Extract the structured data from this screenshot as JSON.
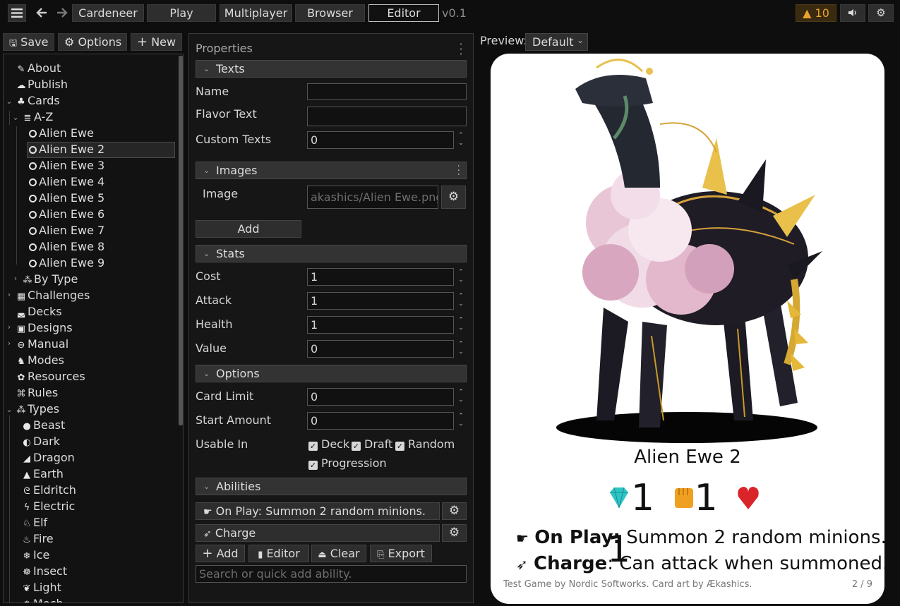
{
  "topbar": {
    "menu_icon": "hamburger-icon",
    "back_icon": "arrow-left-icon",
    "forward_icon": "arrow-right-icon",
    "tabs": [
      "Cardeneer",
      "Play",
      "Multiplayer",
      "Browser",
      "Editor"
    ],
    "active_tab": "Editor",
    "version": "v0.1",
    "warning_count": "10",
    "warning_icon": "warning-icon",
    "sound_icon": "speaker-icon",
    "settings_icon": "gear-icon"
  },
  "left": {
    "save_label": "Save",
    "options_label": "Options",
    "new_label": "New",
    "tree": {
      "about": "About",
      "publish": "Publish",
      "cards": "Cards",
      "az": "A-Z",
      "cards_list": [
        "Alien Ewe",
        "Alien Ewe 2",
        "Alien Ewe 3",
        "Alien Ewe 4",
        "Alien Ewe 5",
        "Alien Ewe 6",
        "Alien Ewe 7",
        "Alien Ewe 8",
        "Alien Ewe 9"
      ],
      "selected": "Alien Ewe 2",
      "by_type": "By Type",
      "challenges": "Challenges",
      "decks": "Decks",
      "designs": "Designs",
      "manual": "Manual",
      "modes": "Modes",
      "resources": "Resources",
      "rules": "Rules",
      "types": "Types",
      "type_list": [
        "Beast",
        "Dark",
        "Dragon",
        "Earth",
        "Eldritch",
        "Electric",
        "Elf",
        "Fire",
        "Ice",
        "Insect",
        "Light",
        "Mech"
      ]
    }
  },
  "properties": {
    "title": "Properties",
    "texts_header": "Texts",
    "name_label": "Name",
    "name_value": "",
    "flavor_label": "Flavor Text",
    "flavor_value": "",
    "custom_label": "Custom Texts",
    "custom_value": "0",
    "images_header": "Images",
    "image_label": "Image",
    "image_placeholder": "akashics/Alien Ewe.png.",
    "add_label": "Add",
    "stats_header": "Stats",
    "cost_label": "Cost",
    "cost_value": "1",
    "attack_label": "Attack",
    "attack_value": "1",
    "health_label": "Health",
    "health_value": "1",
    "value_label": "Value",
    "value_value": "0",
    "options_header": "Options",
    "card_limit_label": "Card Limit",
    "card_limit_value": "0",
    "start_amount_label": "Start Amount",
    "start_amount_value": "0",
    "usable_in_label": "Usable In",
    "usable": [
      "Deck",
      "Draft",
      "Random",
      "Progression"
    ],
    "abilities_header": "Abilities",
    "ability_1": "On Play: Summon 2 random minions.",
    "ability_2": "Charge",
    "add_ability": "Add",
    "editor_label": "Editor",
    "clear_label": "Clear",
    "export_label": "Export",
    "search_placeholder": "Search or quick add ability."
  },
  "preview": {
    "label": "Preview:",
    "mode": "Default",
    "card": {
      "name": "Alien Ewe 2",
      "cost": "1",
      "attack": "1",
      "health": "1",
      "ability1_name": "On Play:",
      "ability1_text": " Summon 2 random minions.",
      "ability2_name": "Charge",
      "ability2_text": ": Can attack when summoned.",
      "footer": "Test Game by Nordic Softworks. Card art by Ækashics.",
      "page": "2 / 9",
      "colors": {
        "gem": "#2ec4c4",
        "fist": "#f0a020",
        "heart": "#d9252a"
      }
    }
  }
}
